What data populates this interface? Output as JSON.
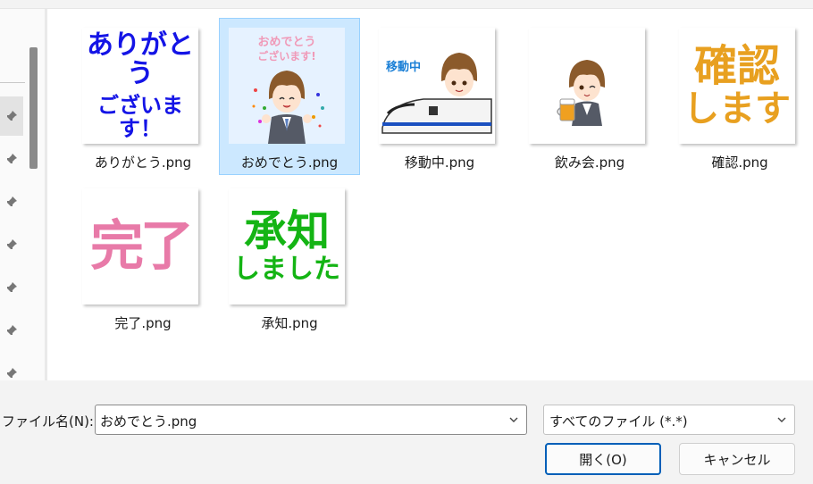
{
  "files": [
    {
      "name": "ありがとう.png",
      "sticker": [
        "ありがとう",
        "ございます！"
      ],
      "color": "#1414e6",
      "selected": false
    },
    {
      "name": "おめでとう.png",
      "sticker": [
        "おめでとう",
        "ございます!"
      ],
      "color": "#f4a3c0",
      "selected": true
    },
    {
      "name": "移動中.png",
      "sticker": [
        "移動中"
      ],
      "color": "#1a7fd6",
      "selected": false
    },
    {
      "name": "飲み会.png",
      "sticker": [],
      "color": "#f0a020",
      "selected": false
    },
    {
      "name": "確認.png",
      "sticker": [
        "確認",
        "します"
      ],
      "color": "#e8a020",
      "selected": false
    },
    {
      "name": "完了.png",
      "sticker": [
        "完了"
      ],
      "color": "#e87aa8",
      "selected": false
    },
    {
      "name": "承知.png",
      "sticker": [
        "承知",
        "しました"
      ],
      "color": "#14b414",
      "selected": false
    }
  ],
  "filename_label": "ファイル名(N):",
  "filename_value": "おめでとう.png",
  "filetype_value": "すべてのファイル (*.*)",
  "open_button": "開く(O)",
  "cancel_button": "キャンセル",
  "icons": {
    "nav": "pin-icon",
    "dropdown": "chevron-down-icon"
  }
}
